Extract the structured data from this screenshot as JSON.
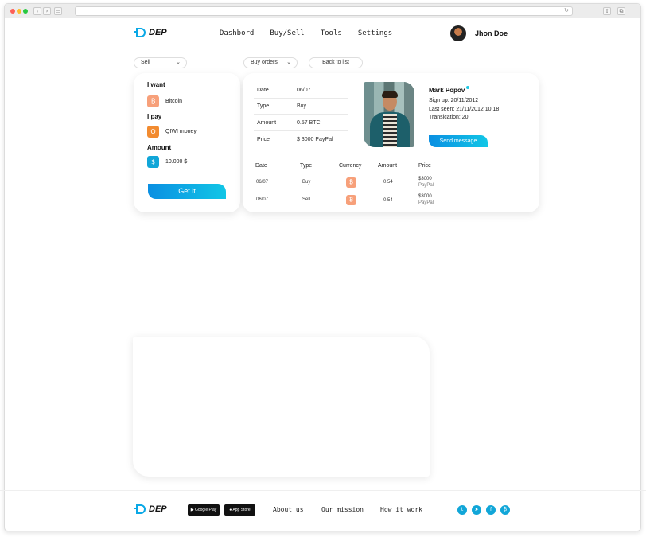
{
  "brand": {
    "name": "DEP",
    "accent": "#11a6d8"
  },
  "nav": [
    "Dashbord",
    "Buy/Sell",
    "Tools",
    "Settings"
  ],
  "user": {
    "name": "Jhon Doe"
  },
  "controls": {
    "side": "Sell",
    "orders": "Buy orders",
    "back": "Back to list"
  },
  "exchange": {
    "want_label": "I want",
    "want_value": "Bitcoin",
    "pay_label": "I pay",
    "pay_value": "QIWI money",
    "amount_label": "Amount",
    "amount_value": "10.000 $",
    "submit": "Get it"
  },
  "order": [
    {
      "k": "Date",
      "v": "06/07"
    },
    {
      "k": "Type",
      "v": "Buy"
    },
    {
      "k": "Amount",
      "v": "0.57 BTC"
    },
    {
      "k": "Price",
      "v": "$ 3000 PayPal"
    }
  ],
  "profile": {
    "name": "Mark Popov",
    "signup": "Sign up: 20/11/2012",
    "last_seen": "Last seen: 21/11/2012 10:18",
    "transactions": "Transication: 20",
    "message_btn": "Send message"
  },
  "history": {
    "headers": [
      "Date",
      "Type",
      "Currency",
      "Amount",
      "Price"
    ],
    "rows": [
      {
        "date": "06/07",
        "type": "Buy",
        "amount": "0.54",
        "price": "$3000",
        "method": "PayPal"
      },
      {
        "date": "06/07",
        "type": "Sell",
        "amount": "0.54",
        "price": "$3000",
        "method": "PayPal"
      }
    ]
  },
  "footer": {
    "google_play": "Google Play",
    "app_store": "App Store",
    "links": [
      "About us",
      "Our mission",
      "How it work"
    ]
  },
  "icons": [
    "bitcoin-icon",
    "qiwi-icon",
    "dollar-icon",
    "twitter-icon",
    "telegram-icon",
    "facebook-icon",
    "bitcoin-social-icon"
  ]
}
